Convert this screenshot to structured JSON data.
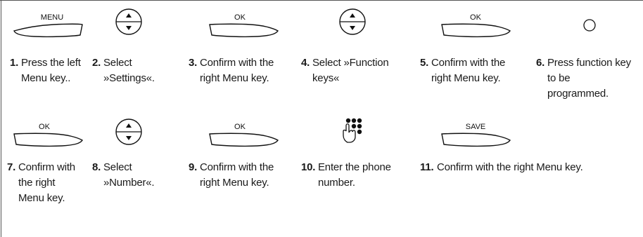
{
  "keys": {
    "menu": "MENU",
    "ok": "OK",
    "save": "SAVE"
  },
  "steps": [
    {
      "num": "1.",
      "text": "Press the left Menu key.."
    },
    {
      "num": "2.",
      "text": "Select »Settings«."
    },
    {
      "num": "3.",
      "text": "Confirm with the right Menu key."
    },
    {
      "num": "4.",
      "text": "Select »Function keys«"
    },
    {
      "num": "5.",
      "text": "Confirm with the right Menu key."
    },
    {
      "num": "6.",
      "text": "Press function key to be programmed."
    },
    {
      "num": "7.",
      "text": "Confirm with the right Menu key."
    },
    {
      "num": "8.",
      "text": "Select »Number«."
    },
    {
      "num": "9.",
      "text": "Confirm with the right Menu key."
    },
    {
      "num": "10.",
      "text": "Enter the phone number."
    },
    {
      "num": "11.",
      "text": "Confirm with the right Menu key."
    }
  ],
  "icons": [
    "left-menu-key-icon",
    "nav-key-icon",
    "right-menu-key-icon",
    "nav-key-icon",
    "right-menu-key-icon",
    "function-key-icon",
    "right-menu-key-icon",
    "nav-key-icon",
    "right-menu-key-icon",
    "keypad-hand-icon",
    "right-menu-key-icon"
  ]
}
